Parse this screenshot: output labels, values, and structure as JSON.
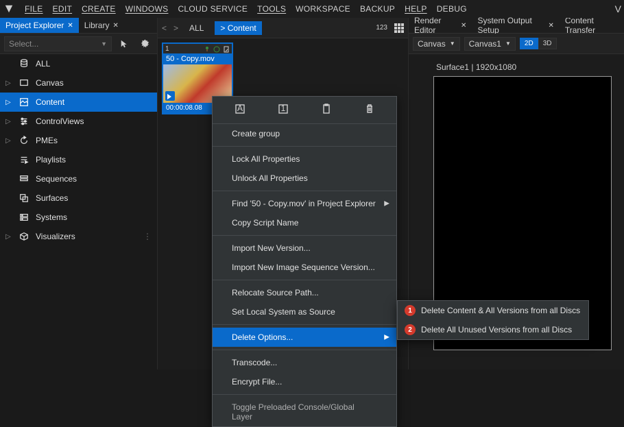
{
  "menubar": {
    "items": [
      "FILE",
      "EDIT",
      "CREATE",
      "WINDOWS",
      "CLOUD SERVICE",
      "TOOLS",
      "WORKSPACE",
      "BACKUP",
      "HELP",
      "DEBUG"
    ]
  },
  "left": {
    "tabs": {
      "project_explorer": "Project Explorer",
      "library": "Library"
    },
    "select_placeholder": "Select...",
    "tree": {
      "all": "ALL",
      "canvas": "Canvas",
      "content": "Content",
      "control_views": "ControlViews",
      "pmes": "PMEs",
      "playlists": "Playlists",
      "sequences": "Sequences",
      "surfaces": "Surfaces",
      "systems": "Systems",
      "visualizers": "Visualizers"
    }
  },
  "mid": {
    "nav_all": "ALL",
    "nav_content": "> Content",
    "num_label": "123",
    "thumb": {
      "index": "1",
      "title": "50 - Copy.mov",
      "time": "00:00:08.08"
    }
  },
  "context_menu": {
    "create_group": "Create group",
    "lock_all": "Lock All Properties",
    "unlock_all": "Unlock All Properties",
    "find": "Find '50 - Copy.mov' in Project Explorer",
    "copy_script": "Copy Script Name",
    "import_new": "Import New Version...",
    "import_new_seq": "Import New Image Sequence Version...",
    "relocate": "Relocate Source Path...",
    "set_local": "Set Local System as Source",
    "delete_options": "Delete Options...",
    "transcode": "Transcode...",
    "encrypt": "Encrypt File...",
    "toggle_preloaded": "Toggle Preloaded Console/Global Layer"
  },
  "submenu": {
    "opt1_num": "1",
    "opt1": "Delete Content & All Versions from all Discs",
    "opt2_num": "2",
    "opt2": "Delete All Unused Versions from all Discs"
  },
  "right": {
    "tabs": {
      "render_editor": "Render Editor",
      "system_output": "System Output Setup",
      "content_transfer": "Content Transfer"
    },
    "dropdown1": "Canvas",
    "dropdown2": "Canvas1",
    "seg_2d": "2D",
    "seg_3d": "3D",
    "surface_label": "Surface1 | 1920x1080"
  }
}
